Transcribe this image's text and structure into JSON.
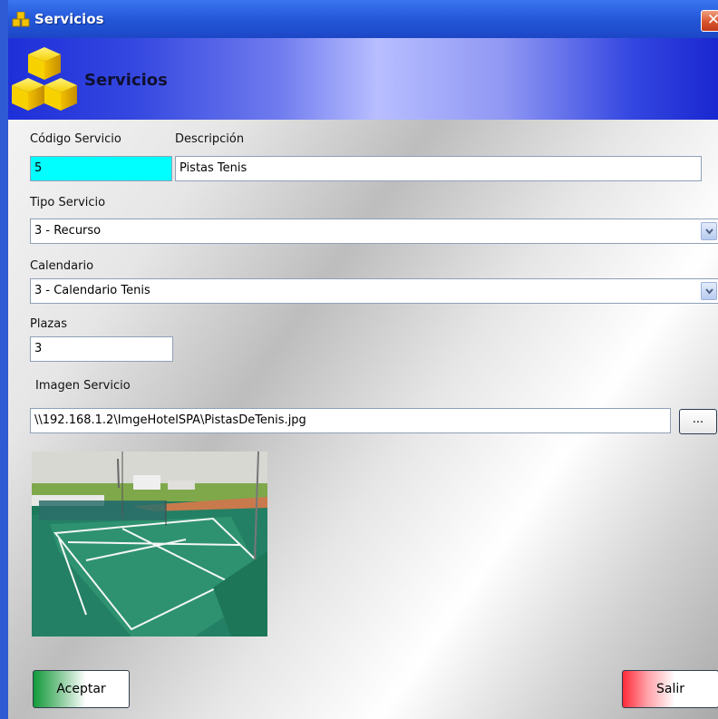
{
  "window": {
    "title": "Servicios",
    "close_label": "✕",
    "app_icon": "stacked-cubes-icon"
  },
  "header": {
    "title": "Servicios",
    "icon": "stacked-cubes-icon"
  },
  "form": {
    "codigo": {
      "label": "Código Servicio",
      "value": "5"
    },
    "descripcion": {
      "label": "Descripción",
      "value": "Pistas Tenis"
    },
    "tipo": {
      "label": "Tipo Servicio",
      "value": "3 - Recurso"
    },
    "calendario": {
      "label": "Calendario",
      "value": "3 - Calendario Tenis"
    },
    "plazas": {
      "label": "Plazas",
      "value": "3"
    },
    "imagen": {
      "label": "Imagen Servicio",
      "value": "\\\\192.168.1.2\\ImgeHotelSPA\\PistasDeTenis.jpg",
      "browse_label": "..."
    }
  },
  "buttons": {
    "accept": "Aceptar",
    "exit": "Salir"
  },
  "colors": {
    "title_bar": "#2457d9",
    "code_field": "#00ffff",
    "accept_accent": "#129a3a",
    "exit_accent": "#ff2b3a"
  }
}
